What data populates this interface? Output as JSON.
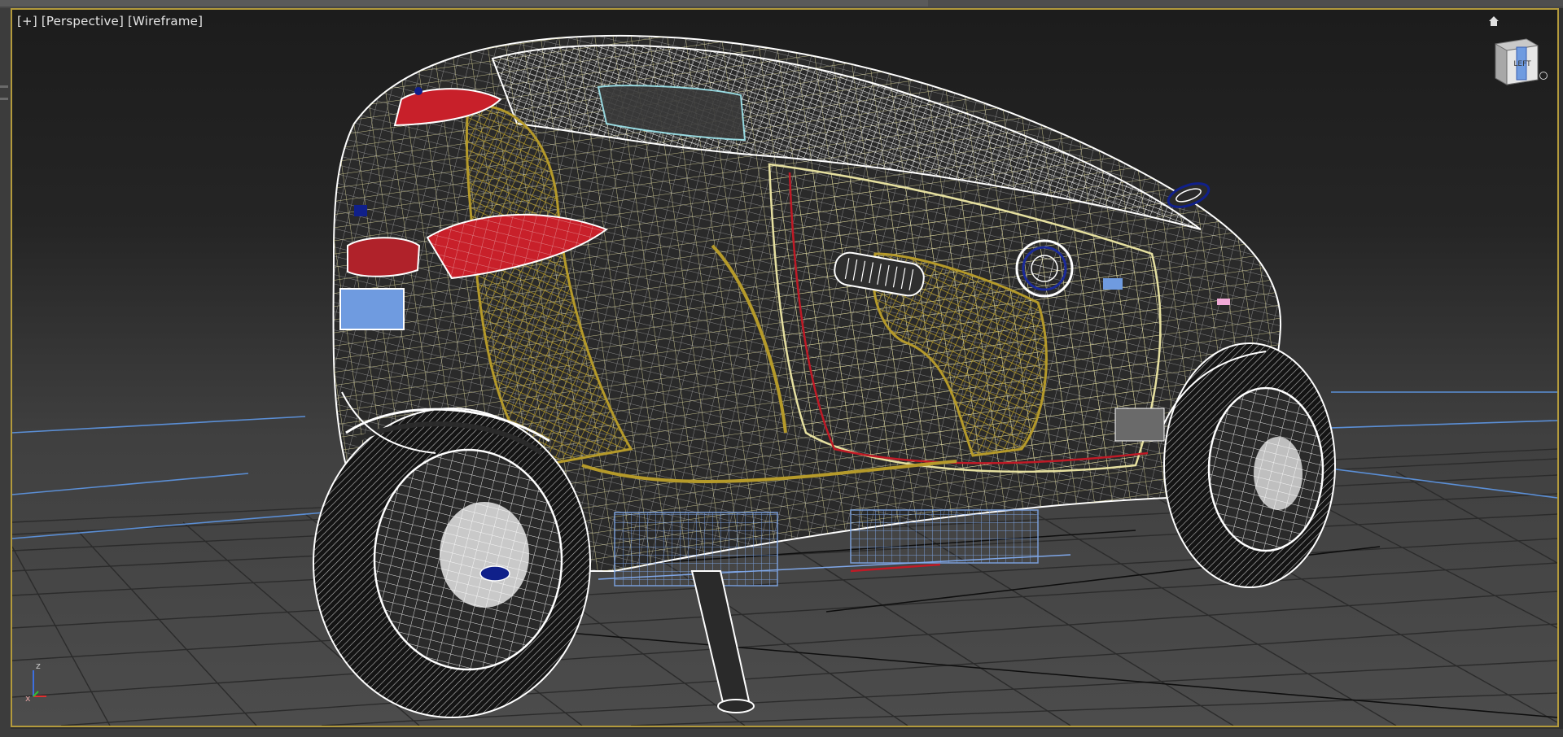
{
  "viewport": {
    "label_plus": "[+]",
    "label_view": "[Perspective]",
    "label_shading": "[Wireframe]",
    "viewcube_face": "LEFT",
    "active_border_color": "#b39a3c"
  },
  "axis": {
    "x": "x",
    "z": "z"
  },
  "colors": {
    "grid": "#2a2a2a",
    "grid_highlight": "#5b8fd6",
    "wire_white": "#ffffff",
    "wire_yellow": "#e6e0a0",
    "wire_gold": "#a89026",
    "light_red": "#c8202a",
    "plate_blue": "#6f9be0",
    "accent_navy": "#10208a"
  },
  "icons": [
    "home-icon",
    "viewcube-icon",
    "axis-tripod-icon"
  ]
}
